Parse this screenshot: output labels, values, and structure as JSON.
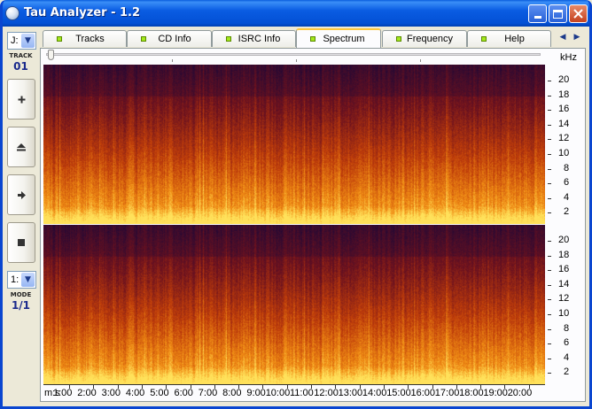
{
  "window": {
    "title": "Tau Analyzer - 1.2"
  },
  "titlebar_buttons": [
    "minimize-button",
    "maximize-button",
    "close-button"
  ],
  "left_toolbar": {
    "drive": "J:",
    "track_caption": "TRACK",
    "track_number": "01",
    "buttons": [
      "plus-icon",
      "eject-icon",
      "play-icon",
      "stop-icon"
    ],
    "mode_select": "1:",
    "mode_caption": "MODE",
    "mode_value": "1/1"
  },
  "tabs": [
    {
      "label": "Tracks",
      "active": false
    },
    {
      "label": "CD Info",
      "active": false
    },
    {
      "label": "ISRC Info",
      "active": false
    },
    {
      "label": "Spectrum",
      "active": true
    },
    {
      "label": "Frequency",
      "active": false
    },
    {
      "label": "Help",
      "active": false
    }
  ],
  "spectrum": {
    "unit_label": "kHz",
    "freq_ticks": [
      "20",
      "18",
      "16",
      "14",
      "12",
      "10",
      "8",
      "6",
      "4",
      "2"
    ],
    "time_prefix": "m:s",
    "time_ticks": [
      "1:00",
      "2:00",
      "3:00",
      "4:00",
      "5:00",
      "6:00",
      "7:00",
      "8:00",
      "9:00",
      "10:00",
      "11:00",
      "12:00",
      "13:00",
      "14:00",
      "15:00",
      "16:00",
      "17:00",
      "18:00",
      "19:00",
      "20:00"
    ],
    "colors": {
      "low": "#2a0a3c",
      "mid": "#b83a0c",
      "high": "#ffd24a"
    }
  }
}
